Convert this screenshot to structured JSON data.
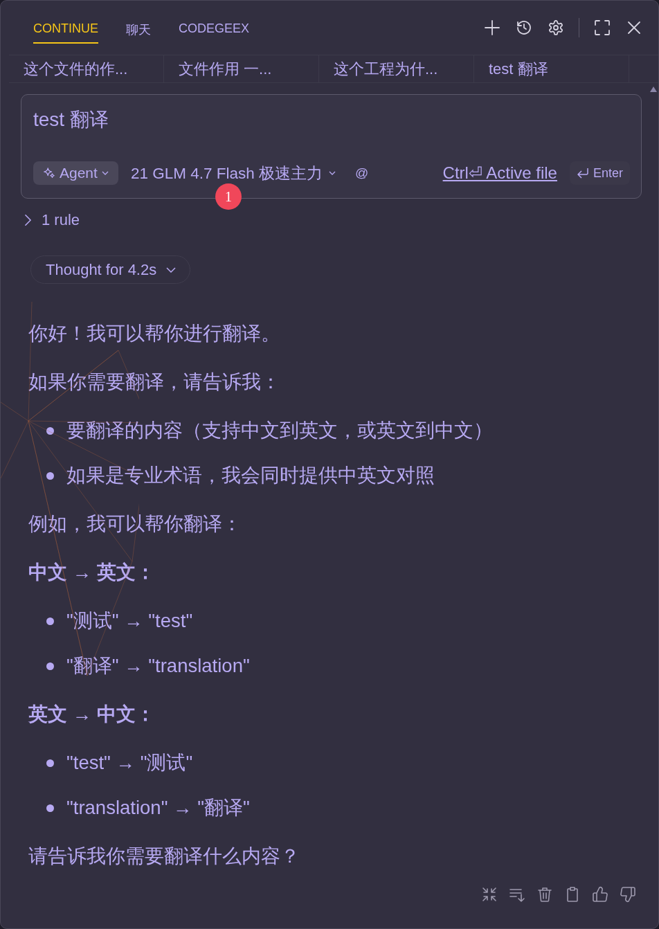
{
  "header": {
    "tabs": [
      {
        "label": "CONTINUE",
        "selected": true
      },
      {
        "label": "聊天",
        "selected": false
      },
      {
        "label": "CODEGEEX",
        "selected": false
      }
    ]
  },
  "sessions": [
    {
      "title": "这个文件的作..."
    },
    {
      "title": "文件作用 一..."
    },
    {
      "title": "这个工程为什..."
    },
    {
      "title": "test 翻译"
    }
  ],
  "input": {
    "value": "test 翻译",
    "mode": "Agent",
    "model": "21 GLM 4.7 Flash 极速主力",
    "mention": "@",
    "context_link": "Ctrl⏎ Active file",
    "submit": "Enter",
    "badge": "1"
  },
  "rules": {
    "label": "1 rule",
    "expanded": false
  },
  "thought": {
    "label": "Thought for 4.2s",
    "expanded": false
  },
  "message": [
    {
      "kind": "paragraph",
      "text": "你好！我可以帮你进行翻译。"
    },
    {
      "kind": "paragraph",
      "text": "如果你需要翻译，请告诉我："
    },
    {
      "kind": "bullets",
      "items": [
        "要翻译的内容（支持中文到英文，或英文到中文）",
        "如果是专业术语，我会同时提供中英文对照"
      ]
    },
    {
      "kind": "paragraph",
      "text": "例如，我可以帮你翻译："
    },
    {
      "kind": "heading",
      "text": "中文 → 英文："
    },
    {
      "kind": "bullets",
      "items": [
        "\"测试\" → \"test\"",
        "\"翻译\" → \"translation\""
      ]
    },
    {
      "kind": "heading",
      "text": "英文 → 中文："
    },
    {
      "kind": "bullets",
      "items": [
        "\"test\" → \"测试\"",
        "\"translation\" → \"翻译\""
      ]
    },
    {
      "kind": "paragraph",
      "text": "请告诉我你需要翻译什么内容？"
    }
  ]
}
